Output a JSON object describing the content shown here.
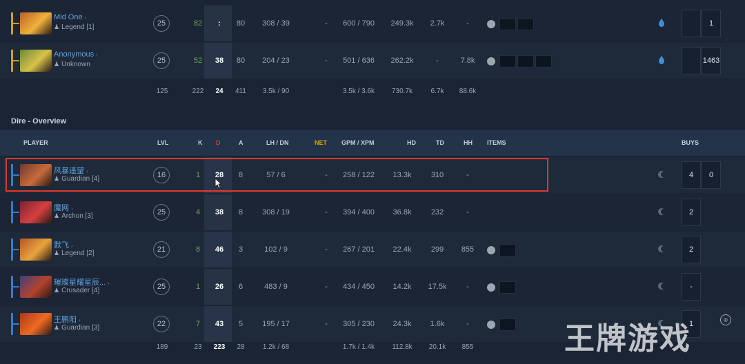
{
  "radiant_players": [
    {
      "name": "Mid One",
      "rank": "Legend [1]",
      "level": "25",
      "lh": "82",
      "k": ":",
      "d": "80",
      "lhdn": "308 / 39",
      "net": "-",
      "gpm": "600 / 790",
      "hd": "249.3k",
      "td": "2.7k",
      "hh": "-",
      "items": 2,
      "buys": [
        "",
        "1"
      ]
    },
    {
      "name": "Anonymous",
      "rank": "Unknown",
      "level": "25",
      "lh": "52",
      "k": "38",
      "d": "80",
      "lhdn": "204 / 23",
      "net": "-",
      "gpm": "501 / 636",
      "hd": "262.2k",
      "td": "-",
      "hh": "7.8k",
      "items": 3,
      "buys": [
        "",
        "1463"
      ]
    }
  ],
  "radiant_totals": {
    "level": "125",
    "lh": "222",
    "k": "24",
    "d": "411",
    "lhdn": "3.5k / 90",
    "gpm": "3.5k / 3.6k",
    "hd": "730.7k",
    "td": "6.7k",
    "hh": "88.6k"
  },
  "dire": {
    "title": "Dire - Overview",
    "headers": {
      "player": "PLAYER",
      "lvl": "LVL",
      "k": "K",
      "d": "D",
      "a": "A",
      "lhdn": "LH / DN",
      "net": "NET",
      "gpm": "GPM / XPM",
      "hd": "HD",
      "td": "TD",
      "hh": "HH",
      "items": "ITEMS",
      "buys": "BUYS"
    },
    "players": [
      {
        "name": "风暴遥望",
        "rank": "Guardian [4]",
        "level": "16",
        "lh": "1",
        "k": "28",
        "d": "8",
        "lhdn": "57 / 6",
        "net": "-",
        "gpm": "258 / 122",
        "hd": "13.3k",
        "td": "310",
        "hh": "-",
        "items": 0,
        "buys": [
          "4",
          "0"
        ]
      },
      {
        "name": "魔网",
        "rank": "Archon [3]",
        "level": "25",
        "lh": "4",
        "k": "38",
        "d": "8",
        "lhdn": "308 / 19",
        "net": "-",
        "gpm": "394 / 400",
        "hd": "36.8k",
        "td": "232",
        "hh": "-",
        "items": 0,
        "buys": [
          "2"
        ]
      },
      {
        "name": "默飞",
        "rank": "Legend [2]",
        "level": "21",
        "lh": "8",
        "k": "46",
        "d": "3",
        "lhdn": "102 / 9",
        "net": "-",
        "gpm": "267 / 201",
        "hd": "22.4k",
        "td": "299",
        "hh": "855",
        "items": 1,
        "buys": [
          "2"
        ]
      },
      {
        "name": "璀璨星耀星辰...",
        "rank": "Crusader [4]",
        "level": "25",
        "lh": "1",
        "k": "26",
        "d": "6",
        "lhdn": "483 / 9",
        "net": "-",
        "gpm": "434 / 450",
        "hd": "14.2k",
        "td": "17.5k",
        "hh": "-",
        "items": 1,
        "buys": [
          "-"
        ]
      },
      {
        "name": "王鹏阳",
        "rank": "Guardian [3]",
        "level": "22",
        "lh": "7",
        "k": "43",
        "d": "5",
        "lhdn": "195 / 17",
        "net": "-",
        "gpm": "305 / 230",
        "hd": "24.3k",
        "td": "1.6k",
        "hh": "-",
        "items": 1,
        "buys": [
          "1"
        ]
      }
    ],
    "totals": {
      "level": "189",
      "lh": "23",
      "k": "223",
      "d": "28",
      "lhdn": "1.2k / 68",
      "gpm": "1.7k / 1.4k",
      "hd": "112.8k",
      "td": "20.1k",
      "hh": "855"
    }
  },
  "watermark": "王牌游戏",
  "colors": {
    "radiant_accent": "#c9a227",
    "dire_accent": "#3b7bc4",
    "highlight": "#e0392b",
    "death_red": "#e0392b",
    "net_gold": "#d4a017",
    "lh_green": "#6aa84f"
  }
}
